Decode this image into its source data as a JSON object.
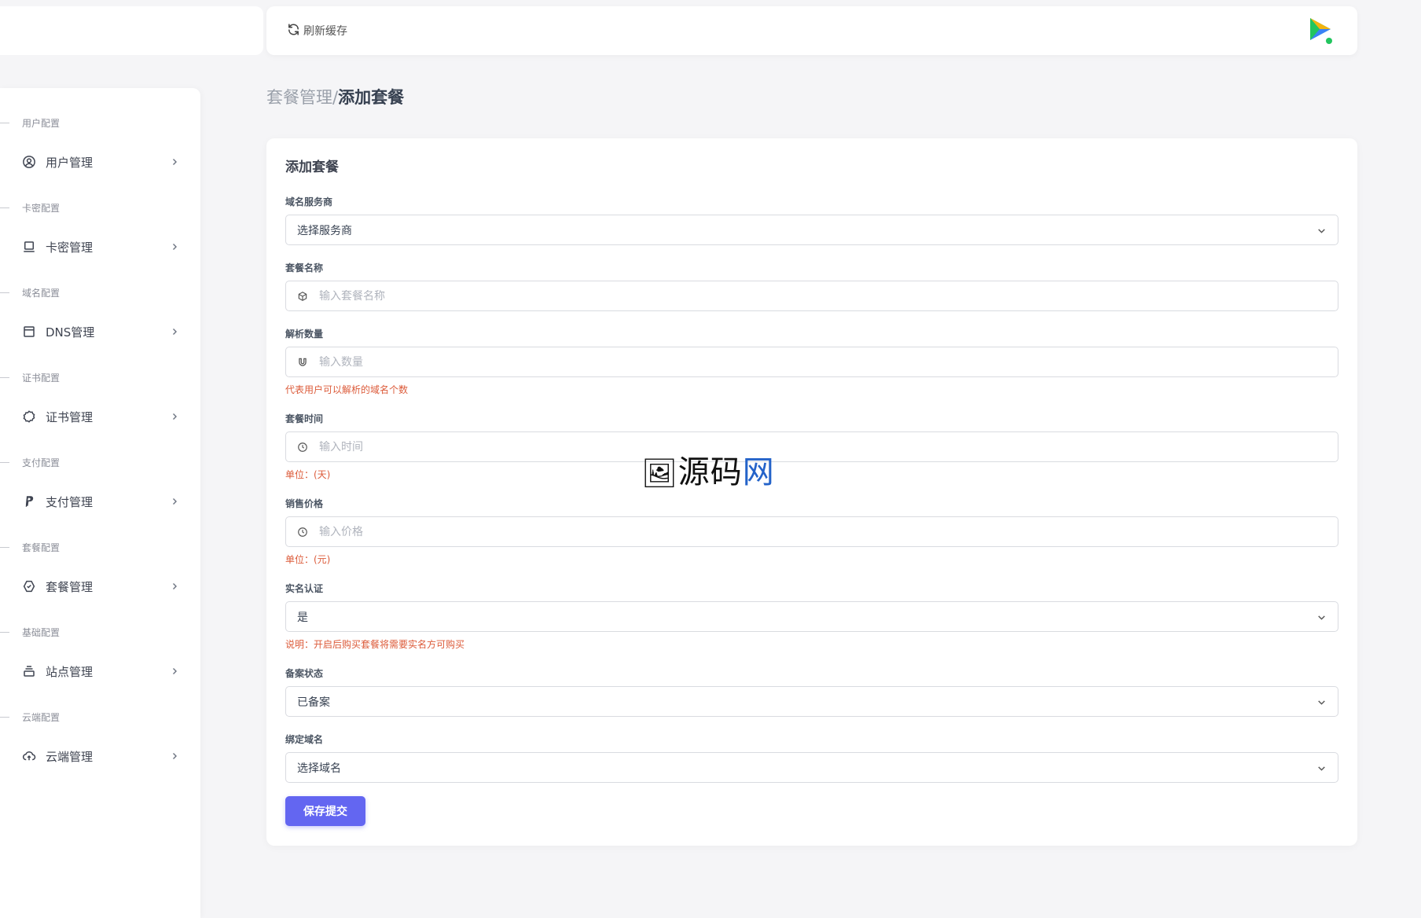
{
  "header": {
    "refresh_label": "刷新缓存",
    "app_icon": "play-logo-icon"
  },
  "sidebar": {
    "sections": [
      {
        "label": "用户配置",
        "item": "用户管理",
        "icon": "user-circle-icon"
      },
      {
        "label": "卡密配置",
        "item": "卡密管理",
        "icon": "laptop-icon"
      },
      {
        "label": "域名配置",
        "item": "DNS管理",
        "icon": "window-icon"
      },
      {
        "label": "证书配置",
        "item": "证书管理",
        "icon": "badge-icon"
      },
      {
        "label": "支付配置",
        "item": "支付管理",
        "icon": "paypal-icon"
      },
      {
        "label": "套餐配置",
        "item": "套餐管理",
        "icon": "package-icon"
      },
      {
        "label": "基础配置",
        "item": "站点管理",
        "icon": "stack-icon"
      },
      {
        "label": "云端配置",
        "item": "云端管理",
        "icon": "cloud-upload-icon"
      }
    ]
  },
  "breadcrumb": {
    "parent": "套餐管理/",
    "current": "添加套餐"
  },
  "form": {
    "title": "添加套餐",
    "provider": {
      "label": "域名服务商",
      "value": "选择服务商"
    },
    "name": {
      "label": "套餐名称",
      "placeholder": "输入套餐名称"
    },
    "count": {
      "label": "解析数量",
      "placeholder": "输入数量",
      "hint": "代表用户可以解析的域名个数"
    },
    "duration": {
      "label": "套餐时间",
      "placeholder": "输入时间",
      "hint": "单位：(天)"
    },
    "price": {
      "label": "销售价格",
      "placeholder": "输入价格",
      "hint": "单位：(元)"
    },
    "realname": {
      "label": "实名认证",
      "value": "是",
      "hint": "说明：开启后购买套餐将需要实名方可购买"
    },
    "icp": {
      "label": "备案状态",
      "value": "已备案"
    },
    "domain": {
      "label": "绑定域名",
      "value": "选择域名"
    },
    "submit_label": "保存提交"
  },
  "watermark": {
    "text_a": "源码",
    "text_b": "网"
  },
  "colors": {
    "primary": "#6366f1",
    "hint": "#dc5b3a"
  }
}
